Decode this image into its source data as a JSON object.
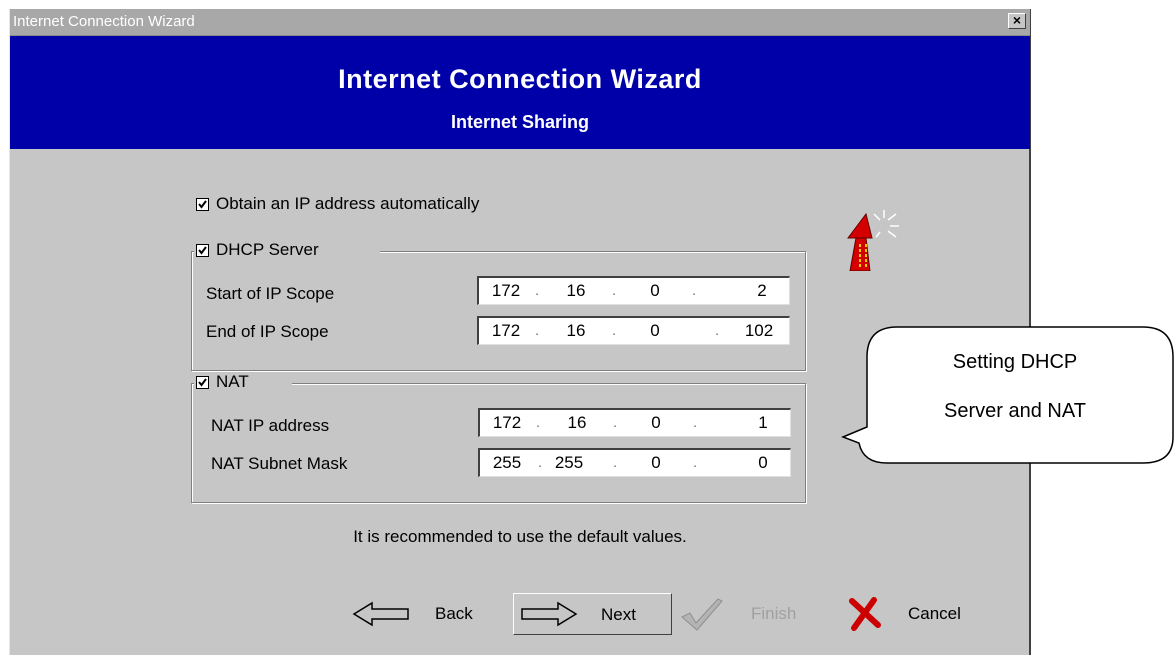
{
  "window": {
    "title": "Internet Connection Wizard",
    "close_label": "×"
  },
  "banner": {
    "title": "Internet Connection Wizard",
    "subtitle": "Internet Sharing"
  },
  "options": {
    "obtain_ip": {
      "label": "Obtain an IP address automatically",
      "checked": true
    },
    "dhcp": {
      "label": "DHCP Server",
      "checked": true,
      "start_label": "Start of IP Scope",
      "start_ip": [
        "172",
        "16",
        "0",
        "2"
      ],
      "end_label": "End of IP Scope",
      "end_ip": [
        "172",
        "16",
        "0",
        "102"
      ]
    },
    "nat": {
      "label": "NAT",
      "checked": true,
      "ip_label": "NAT IP address",
      "ip": [
        "172",
        "16",
        "0",
        "1"
      ],
      "mask_label": "NAT Subnet Mask",
      "mask": [
        "255",
        "255",
        "0",
        "0"
      ]
    }
  },
  "notice": "It is recommended to use the default values.",
  "buttons": {
    "back": "Back",
    "next": "Next",
    "finish": "Finish",
    "cancel": "Cancel"
  },
  "callout": {
    "line1": "Setting DHCP",
    "line2": "Server and NAT"
  },
  "icons": {
    "logo": "red-arrow-logo-icon",
    "back": "back-arrow-icon",
    "next": "next-arrow-icon",
    "finish": "checkmark-icon",
    "cancel": "x-cancel-icon"
  },
  "colors": {
    "banner": "#0000a8",
    "dialog": "#c6c6c6",
    "cancel_x": "#cc0000",
    "finish_disabled": "#a0a0a0"
  }
}
